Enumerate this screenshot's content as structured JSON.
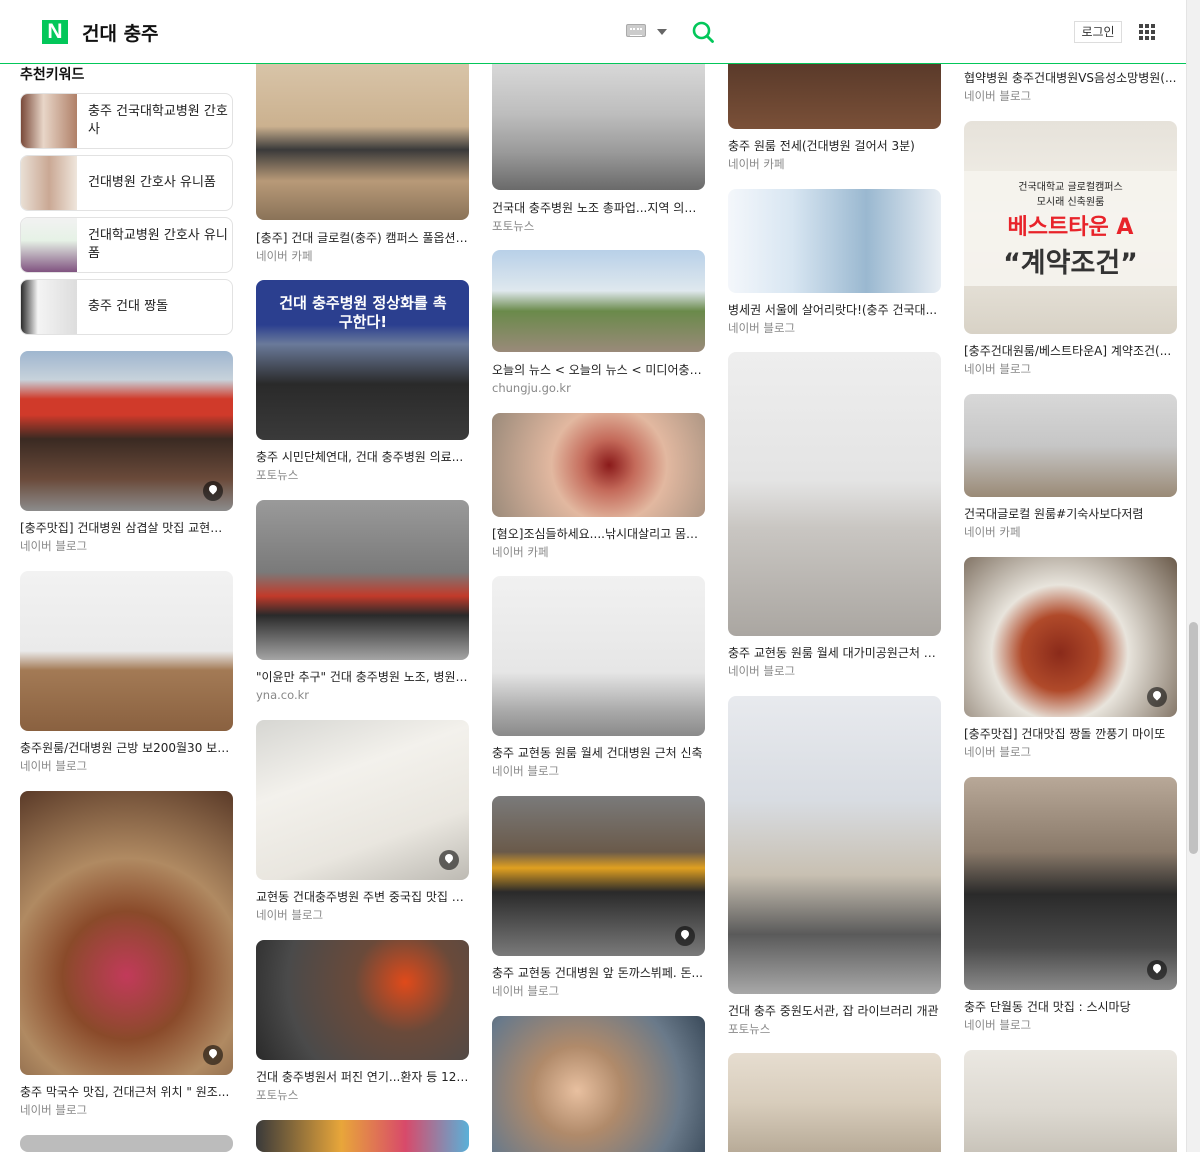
{
  "header": {
    "logo": "N",
    "query": "건대 충주",
    "login_label": "로그인"
  },
  "icons": [
    "keyboard-icon",
    "dropdown-caret-icon",
    "search-icon",
    "apps-grid-icon",
    "map-pin-icon"
  ],
  "colors": {
    "brand": "#03c75a"
  },
  "keywords": {
    "title": "추천키워드",
    "items": [
      {
        "label": "충주 건국대학교병원 간호사"
      },
      {
        "label": "건대병원 간호사 유니폼"
      },
      {
        "label": "건대학교병원 간호사 유니폼"
      },
      {
        "label": "충주 건대 짱돌"
      }
    ]
  },
  "col1": [
    {
      "title": "[충주맛집] 건대병원 삼겹살 맛집 교현동 고깃집",
      "source": "네이버 블로그"
    },
    {
      "title": "충주원룸/건대병원 근방 보200월30 보3...",
      "source": "네이버 블로그"
    },
    {
      "title": "충주 막국수 맛집, 건대근처 위치 \" 원조...",
      "source": "네이버 블로그"
    }
  ],
  "col2": [
    {
      "title": "[충주] 건대 글로컬(충주) 캠퍼스 풀옵션 ...",
      "source": "네이버 카페"
    },
    {
      "title": "충주 시민단체연대, 건대 충주병원 의료...",
      "source": "포토뉴스",
      "banner": "건대 충주병원 정상화를 촉구한다!"
    },
    {
      "title": "\"이윤만 추구\" 건대 충주병원 노조, 병원 ...",
      "source": "yna.co.kr"
    },
    {
      "title": "교현동 건대충주병원 주변 중국집 맛집 청...",
      "source": "네이버 블로그"
    },
    {
      "title": "건대 충주병원서 퍼진 연기...환자 등 120...",
      "source": "포토뉴스"
    }
  ],
  "col3": [
    {
      "title": "건국대 충주병원 노조 총파업...지역 의료 ...",
      "source": "포토뉴스"
    },
    {
      "title": "오늘의 뉴스 < 오늘의 뉴스 < 미디어충주...",
      "source": "chungju.go.kr"
    },
    {
      "title": "[혐오]조심들하세요....낚시대살리고 몸이...",
      "source": "네이버 카페"
    },
    {
      "title": "충주 교현동 원룸 월세 건대병원 근처 신축",
      "source": "네이버 블로그"
    },
    {
      "title": "충주 교현동 건대병원 앞 돈까스뷔페. 돈...",
      "source": "네이버 블로그"
    }
  ],
  "col4": [
    {
      "title": "충주 원룸 전세(건대병원 걸어서 3분)",
      "source": "네이버 카페"
    },
    {
      "title": "병세권 서울에 살어리랏다!(충주 건국대...",
      "source": "네이버 블로그"
    },
    {
      "title": "충주 교현동 원룸 월세 대가미공원근처 건...",
      "source": "네이버 블로그"
    },
    {
      "title": "건대 충주 중원도서관, 잡 라이브러리 개관",
      "source": "포토뉴스"
    }
  ],
  "col5": [
    {
      "title": "협약병원 충주건대병원VS음성소망병원(...",
      "source": "네이버 블로그"
    },
    {
      "title": "[충주건대원룸/베스트타운A] 계약조건(...",
      "source": "네이버 블로그",
      "poster_line1": "건국대학교 글로컬캠퍼스",
      "poster_line2": "모시래 신축원룸",
      "poster_line3": "베스트타운 A",
      "poster_line4": "“계약조건”"
    },
    {
      "title": "건국대글로컬 원룸#기숙사보다저렴",
      "source": "네이버 카페"
    },
    {
      "title": "[충주맛집] 건대맛집 짱돌 깐풍기 마이또",
      "source": "네이버 블로그"
    },
    {
      "title": "충주 단월동 건대 맛집 : 스시마당",
      "source": "네이버 블로그"
    }
  ]
}
